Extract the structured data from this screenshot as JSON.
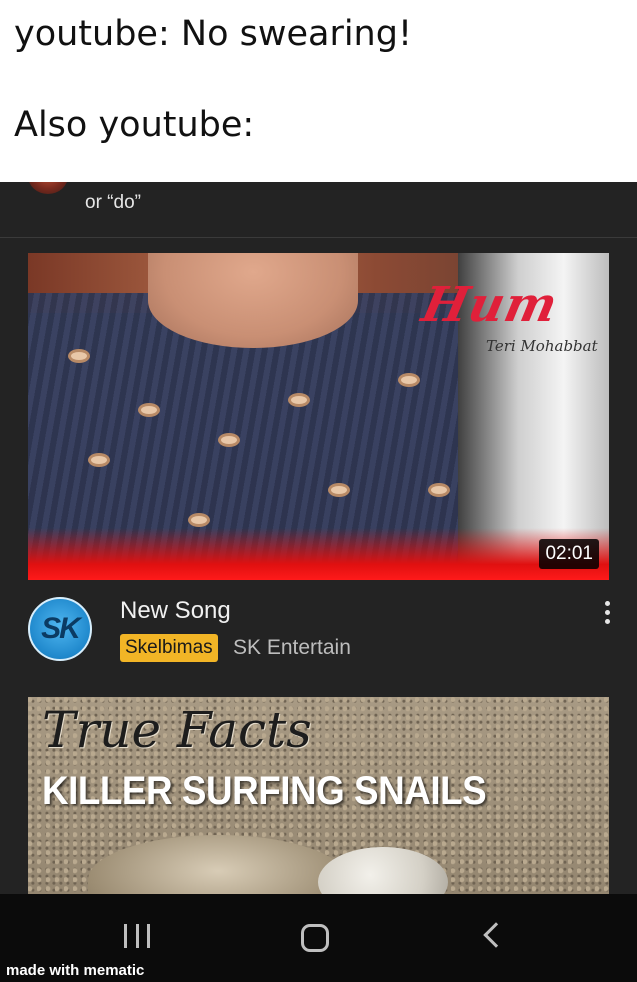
{
  "caption": {
    "line1": "youtube: No swearing!",
    "line2": "Also youtube:"
  },
  "comment": {
    "text": "or “do”"
  },
  "videos": [
    {
      "thumbnail_title": "Hum",
      "thumbnail_subtitle": "Teri Mohabbat",
      "duration": "02:01",
      "title": "New Song",
      "channel_badge": "Skelbimas",
      "channel_name": "SK Entertain",
      "channel_avatar_text": "SK"
    },
    {
      "thumbnail_script": "True Facts",
      "thumbnail_headline": "KILLER SURFING SNAILS"
    }
  ],
  "navbar": {
    "icons": [
      "recent-apps-icon",
      "home-icon",
      "back-icon"
    ]
  },
  "watermark": "made with mematic",
  "colors": {
    "screen_bg": "#232323",
    "badge": "#f2b526",
    "navbar_bg": "#0b0b0b",
    "accent_red": "#e01010"
  }
}
